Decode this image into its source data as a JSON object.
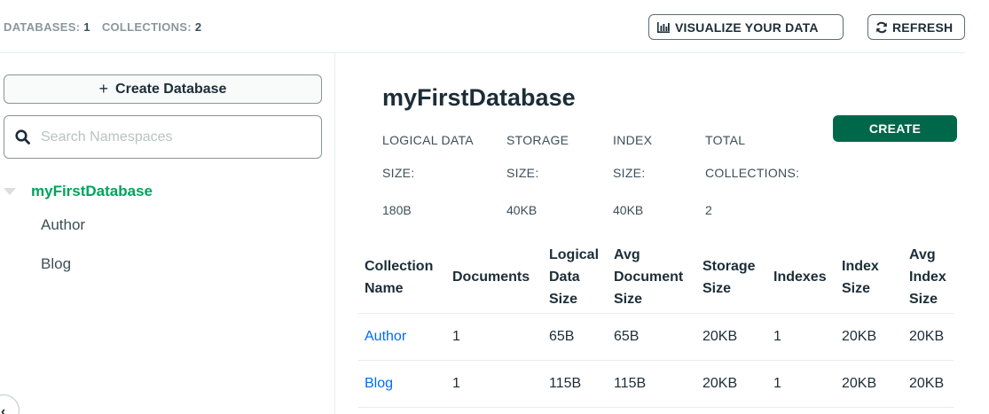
{
  "topbar": {
    "databases_label": "DATABASES:",
    "databases_count": "1",
    "collections_label": "COLLECTIONS:",
    "collections_count": "2",
    "visualize_label": "VISUALIZE YOUR DATA",
    "refresh_label": "REFRESH"
  },
  "sidebar": {
    "create_db_label": "Create Database",
    "search_placeholder": "Search Namespaces",
    "database": "myFirstDatabase",
    "collections": [
      "Author",
      "Blog"
    ]
  },
  "main": {
    "title": "myFirstDatabase",
    "create_label": "CREATE",
    "stats": [
      {
        "label_line1": "LOGICAL DATA",
        "label_line2": "SIZE:",
        "value": "180B"
      },
      {
        "label_line1": "STORAGE",
        "label_line2": "SIZE:",
        "value": "40KB"
      },
      {
        "label_line1": "INDEX",
        "label_line2": "SIZE:",
        "value": "40KB"
      },
      {
        "label_line1": "TOTAL",
        "label_line2": "COLLECTIONS:",
        "value": "2"
      }
    ],
    "table": {
      "headers": [
        "Collection Name",
        "Documents",
        "Logical Data Size",
        "Avg Document Size",
        "Storage Size",
        "Indexes",
        "Index Size",
        "Avg Index Size"
      ],
      "rows": [
        [
          "Author",
          "1",
          "65B",
          "65B",
          "20KB",
          "1",
          "20KB",
          "20KB"
        ],
        [
          "Blog",
          "1",
          "115B",
          "115B",
          "20KB",
          "1",
          "20KB",
          "20KB"
        ]
      ]
    }
  },
  "colors": {
    "accent_green": "#00a35c",
    "create_button": "#00684a",
    "link_blue": "#016bf8"
  },
  "icons": {
    "visualize": "bar-chart-icon",
    "refresh": "refresh-icon",
    "search": "search-icon",
    "caret": "caret-down-icon"
  }
}
